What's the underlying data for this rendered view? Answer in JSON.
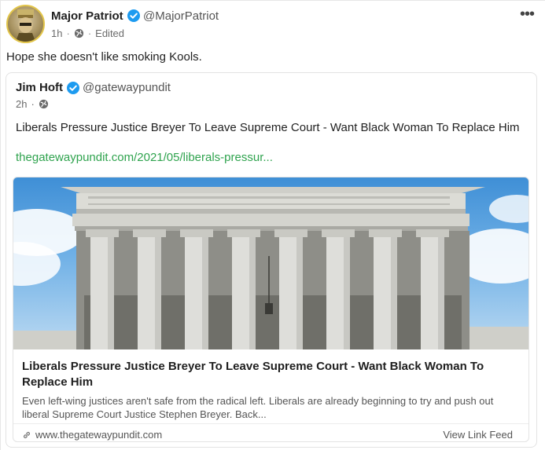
{
  "post": {
    "author_name": "Major Patriot",
    "author_handle": "@MajorPatriot",
    "time": "1h",
    "edited": "Edited",
    "more_label": "•••",
    "text": "Hope she doesn't like smoking Kools."
  },
  "quoted": {
    "author_name": "Jim Hoft",
    "author_handle": "@gatewaypundit",
    "time": "2h",
    "text": "Liberals Pressure Justice Breyer To Leave Supreme Court - Want Black Woman To Replace Him",
    "link_text": "thegatewaypundit.com/2021/05/liberals-pressur..."
  },
  "link_card": {
    "title": "Liberals Pressure Justice Breyer To Leave Supreme Court - Want Black Woman To Replace Him",
    "description": "Even left-wing justices aren't safe from the radical left. Liberals are already beginning to try and push out liberal Supreme Court Justice Stephen Breyer. Back...",
    "domain": "www.thegatewaypundit.com",
    "action_label": "View Link Feed",
    "image_icon": "supreme-court-building-photo"
  },
  "colors": {
    "verified_blue": "#1d9bf0",
    "link_green": "#2fa34e",
    "avatar_ring": "#e2c54a"
  },
  "icons": {
    "verified": "verified-check-icon",
    "visibility": "globe-icon",
    "link": "link-icon",
    "more": "more-dots-icon"
  }
}
